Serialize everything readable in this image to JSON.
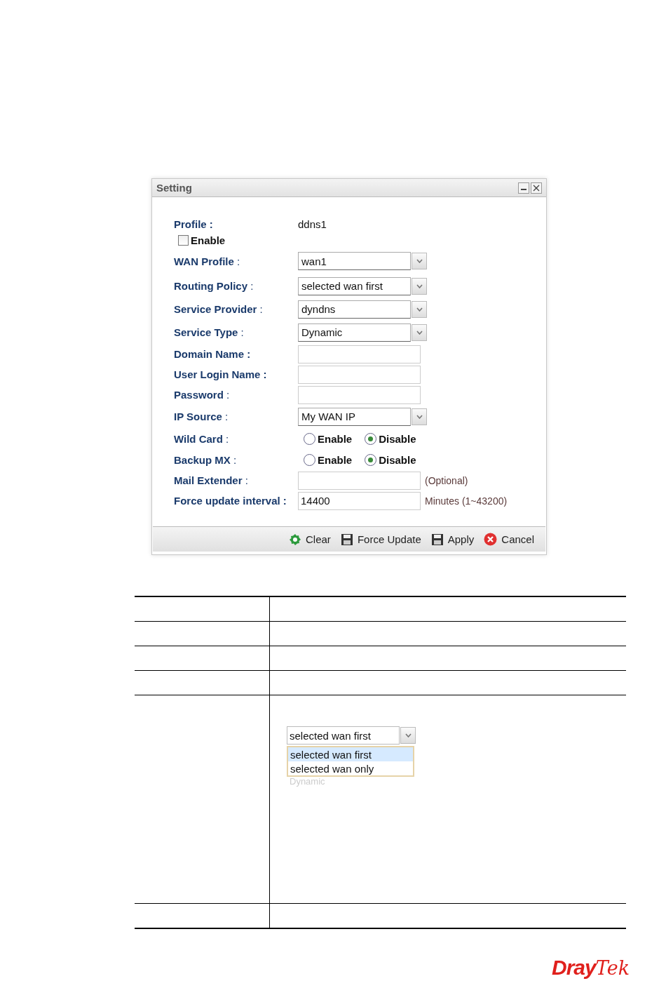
{
  "dialog": {
    "title": "Setting",
    "fields": [
      {
        "kind": "text",
        "label": "**Profile :**",
        "value": "ddns1"
      },
      {
        "kind": "checkbox",
        "label": "Enable",
        "checked": false
      },
      {
        "kind": "select",
        "label": "**WAN Profile** :",
        "value": "wan1"
      },
      {
        "kind": "select",
        "label": "**Routing Policy** :",
        "value": "selected wan first"
      },
      {
        "kind": "select",
        "label": "**Service Provider** :",
        "value": "dyndns"
      },
      {
        "kind": "select",
        "label": "**Service Type** :",
        "value": "Dynamic"
      },
      {
        "kind": "input",
        "label": "**Domain Name :**"
      },
      {
        "kind": "input",
        "label": "**User Login Name :**"
      },
      {
        "kind": "input",
        "label": "**Password** :"
      },
      {
        "kind": "select",
        "label": "**IP Source** :",
        "value": "My WAN IP"
      },
      {
        "kind": "radio",
        "label": "**Wild Card** :",
        "options": [
          {
            "label": "Enable",
            "selected": false
          },
          {
            "label": "Disable",
            "selected": true
          }
        ]
      },
      {
        "kind": "radio",
        "label": "**Backup MX** :",
        "options": [
          {
            "label": "Enable",
            "selected": false
          },
          {
            "label": "Disable",
            "selected": true
          }
        ]
      },
      {
        "kind": "input",
        "label": "**Mail Extender** :",
        "note": "(Optional)"
      },
      {
        "kind": "input",
        "label": "**Force update interval :**",
        "value": "14400",
        "note": "Minutes (1~43200)"
      }
    ],
    "buttons": [
      {
        "kind": "gear",
        "label": "Clear"
      },
      {
        "kind": "disk",
        "label": "Force Update"
      },
      {
        "kind": "disk",
        "label": "Apply"
      },
      {
        "kind": "cancel",
        "label": "Cancel"
      }
    ]
  },
  "table": {
    "rows": [
      {
        "kind": "blank"
      },
      {
        "kind": "blank"
      },
      {
        "kind": "blank"
      },
      {
        "kind": "blank"
      },
      {
        "kind": "inset",
        "inset": {
          "value": "selected wan first",
          "options": [
            {
              "label": "selected wan first",
              "selected": true
            },
            {
              "label": "selected wan only",
              "selected": false
            }
          ],
          "below": "Dynamic"
        }
      },
      {
        "kind": "blank"
      }
    ]
  },
  "logo": {
    "first": "Dray",
    "second": "Tek"
  }
}
